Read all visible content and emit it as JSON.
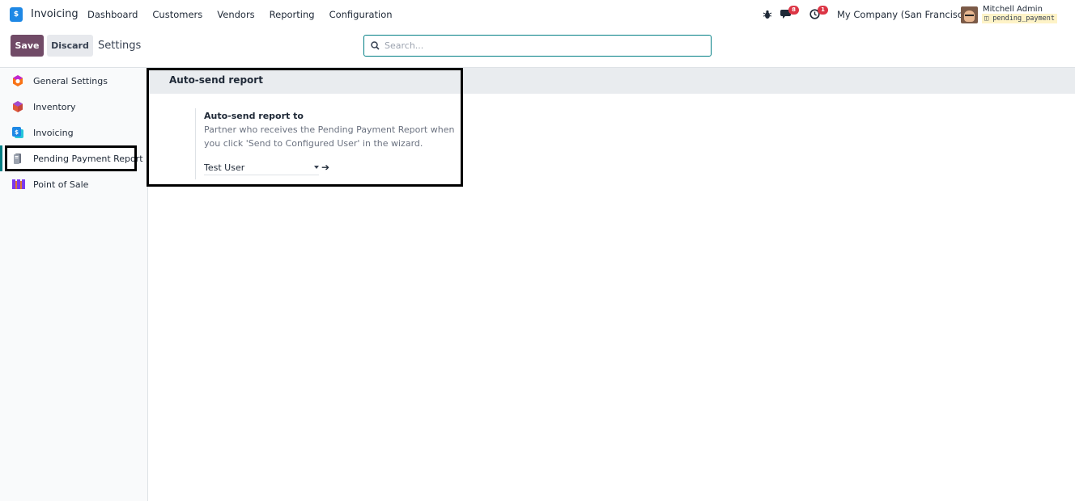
{
  "navbar": {
    "app_name": "Invoicing",
    "app_logo_glyph": "$",
    "menu": [
      "Dashboard",
      "Customers",
      "Vendors",
      "Reporting",
      "Configuration"
    ],
    "messages_count": "8",
    "activities_count": "1",
    "company": "My Company (San Francisco)",
    "user_name": "Mitchell Admin",
    "database": "pending_payment"
  },
  "control": {
    "save_label": "Save",
    "discard_label": "Discard",
    "breadcrumb": "Settings",
    "search_placeholder": "Search..."
  },
  "sidebar": {
    "items": [
      {
        "label": "General Settings",
        "icon": "settings-logo-icon"
      },
      {
        "label": "Inventory",
        "icon": "inventory-icon"
      },
      {
        "label": "Invoicing",
        "icon": "invoicing-icon"
      },
      {
        "label": "Pending Payment Report",
        "icon": "pending-payment-report-icon",
        "selected": true
      },
      {
        "label": "Point of Sale",
        "icon": "point-of-sale-icon"
      }
    ]
  },
  "content": {
    "section_title": "Auto-send report",
    "setting_label": "Auto-send report to",
    "setting_description": "Partner who receives the Pending Payment Report when you click 'Send to Configured User' in the wizard.",
    "field_value": "Test User"
  },
  "colors": {
    "brand": "#714b67",
    "accent": "#017e84",
    "badge": "#dc3545"
  }
}
